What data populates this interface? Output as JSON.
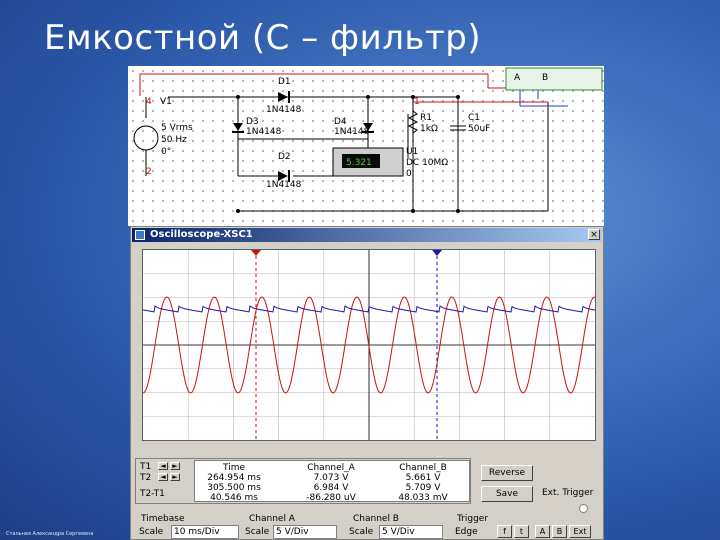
{
  "slide": {
    "title": "Емкостной (С – фильтр)",
    "credit": "Стальная Александра Сергеевна"
  },
  "schematic": {
    "labels": {
      "v1": "V1",
      "v1_amp": "5 Vrms",
      "v1_freq": "50 Hz",
      "v1_phase": "0°",
      "node4": "4",
      "node2": "2",
      "node1": "1",
      "d1": "D1",
      "d1_part": "1N4148",
      "d3": "D3",
      "d3_part": "1N4148",
      "d4": "D4",
      "d4_part": "1N4148",
      "d2": "D2",
      "d2_part": "1N4148",
      "r1": "R1",
      "r1_val": "1kΩ",
      "c1": "C1",
      "c1_val": "50uF",
      "u1": "U1",
      "u1_mode": "DC  10MΩ",
      "u1_extra": "0",
      "meter_value": "5.321",
      "scope_a": "A",
      "scope_b": "B"
    }
  },
  "oscilloscope": {
    "title": "Oscilloscope-XSC1",
    "close_label": "×",
    "readout": {
      "row_labels": [
        "T1",
        "T2",
        "T2-T1"
      ],
      "columns": {
        "time": [
          "Time",
          "264.954 ms",
          "305.500 ms",
          "40.546 ms"
        ],
        "channel_a": [
          "Channel_A",
          "7.073 V",
          "6.984 V",
          "-86.280 uV"
        ],
        "channel_b": [
          "Channel_B",
          "5.661 V",
          "5.709 V",
          "48.033 mV"
        ]
      }
    },
    "buttons": {
      "reverse": "Reverse",
      "save": "Save",
      "ext_trigger": "Ext. Trigger"
    },
    "timebase": {
      "group": "Timebase",
      "scale_label": "Scale",
      "scale_value": "10 ms/Div"
    },
    "channel_a": {
      "group": "Channel A",
      "scale_label": "Scale",
      "scale_value": "5 V/Div"
    },
    "channel_b": {
      "group": "Channel B",
      "scale_label": "Scale",
      "scale_value": "5 V/Div"
    },
    "trigger": {
      "group": "Trigger",
      "edge_label": "Edge",
      "buttons": [
        "f",
        "t",
        "A",
        "B",
        "Ext"
      ]
    },
    "colors": {
      "channel_a": "#cc1111",
      "channel_b": "#1a1aa0",
      "cursor_t1": "#cc1111",
      "cursor_t2": "#1a1aa0"
    }
  }
}
